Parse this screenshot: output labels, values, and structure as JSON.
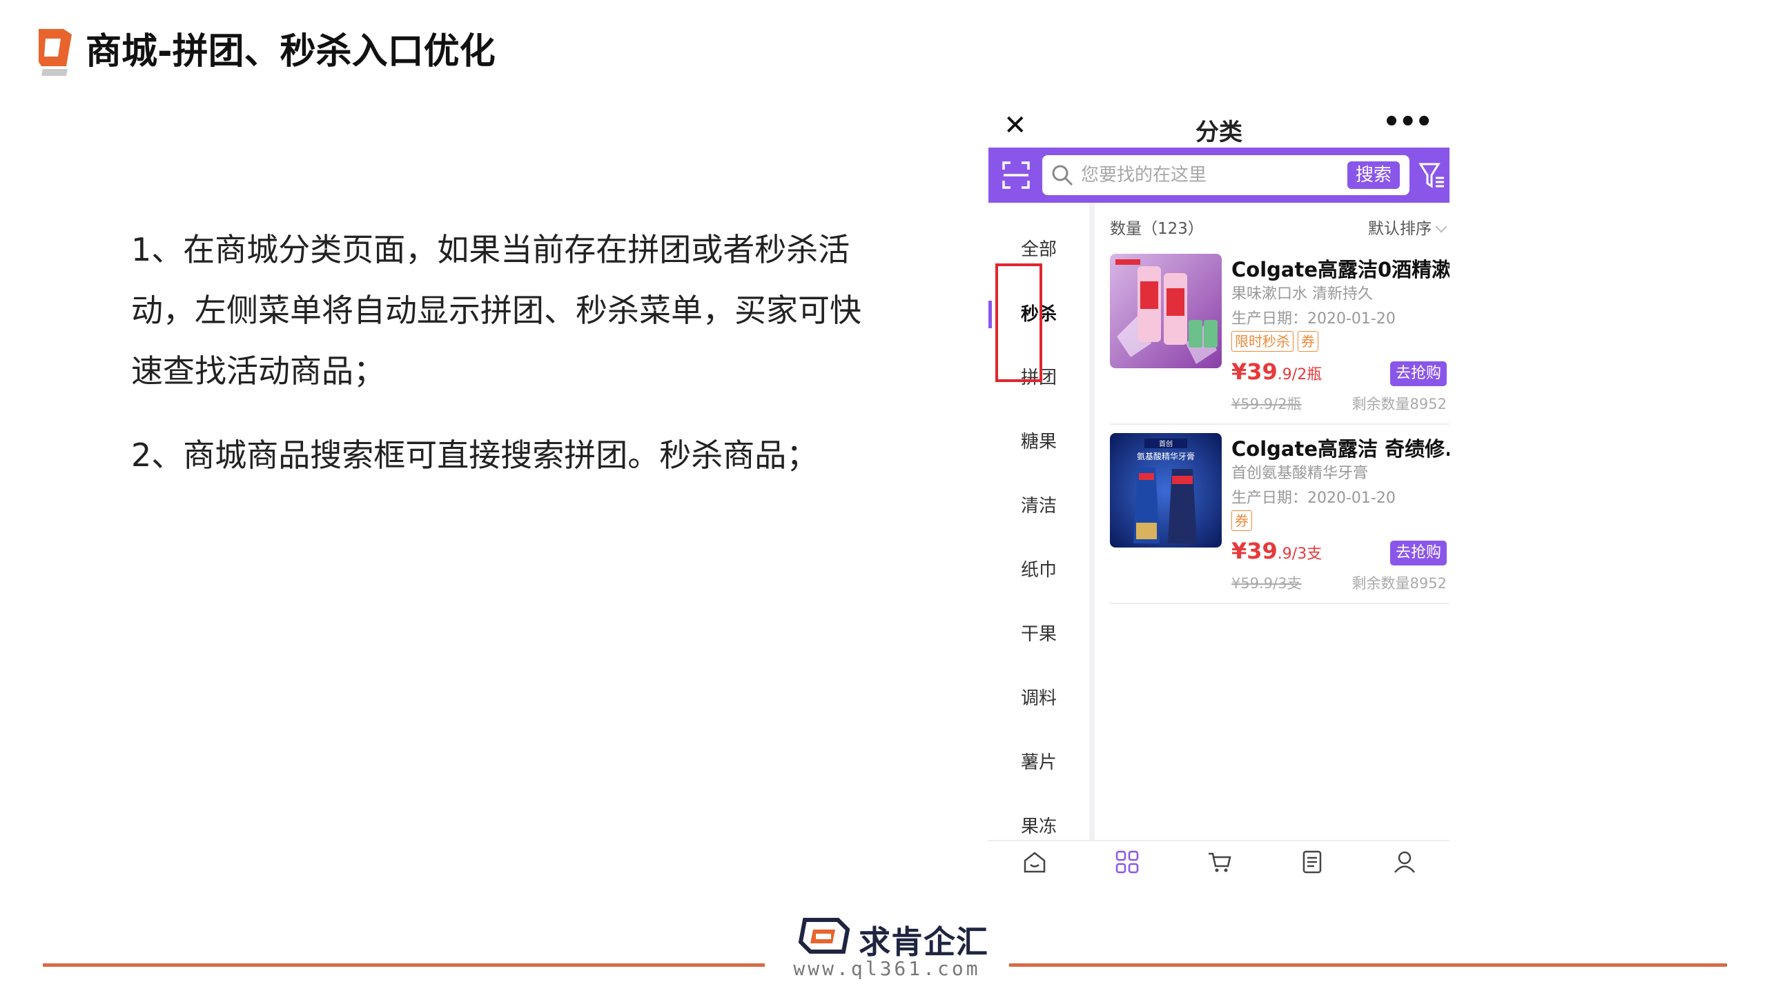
{
  "slide": {
    "title": "商城-拼团、秒杀入口优化",
    "points": [
      "1、在商城分类页面，如果当前存在拼团或者秒杀活动，左侧菜单将自动显示拼团、秒杀菜单，买家可快速查找活动商品；",
      "2、商城商品搜索框可直接搜索拼团。秒杀商品；"
    ]
  },
  "footer": {
    "brand": "求肯企汇",
    "url": "www.ql361.com"
  },
  "phone": {
    "nav": {
      "close": "✕",
      "title": "分类",
      "more": "•••"
    },
    "search": {
      "placeholder": "您要找的在这里",
      "button": "搜索"
    },
    "categories": [
      "全部",
      "秒杀",
      "拼团",
      "糖果",
      "清洁",
      "纸巾",
      "干果",
      "调料",
      "薯片",
      "果冻"
    ],
    "active_category": "秒杀",
    "list": {
      "count_label": "数量（123）",
      "sort_label": "默认排序"
    },
    "products": [
      {
        "name": "Colgate高露洁0酒精漱...",
        "subtitle": "果味漱口水 清新持久",
        "date": "生产日期：2020-01-20",
        "tags": [
          "限时秒杀",
          "券"
        ],
        "price_big": "¥39",
        "price_small": ".9/2瓶",
        "original_price": "¥59.9/2瓶",
        "stock": "剩余数量8952",
        "button": "去抢购"
      },
      {
        "name": "Colgate高露洁 奇绩修...",
        "subtitle": "首创氨基酸精华牙膏",
        "date": "生产日期：2020-01-20",
        "tags": [
          "券"
        ],
        "price_big": "¥39",
        "price_small": ".9/3支",
        "original_price": "¥59.9/3支",
        "stock": "剩余数量8952",
        "button": "去抢购",
        "image_text": [
          "首创",
          "氨基酸精华牙膏"
        ]
      }
    ],
    "tabs": [
      "home-icon",
      "category-icon",
      "cart-icon",
      "orders-icon",
      "profile-icon"
    ],
    "accent": "#8a56ea"
  },
  "colors": {
    "accent_orange": "#d86b45",
    "highlight_red": "#e0262e",
    "price_red": "#e8393a",
    "tag_orange": "#f08a3a"
  }
}
